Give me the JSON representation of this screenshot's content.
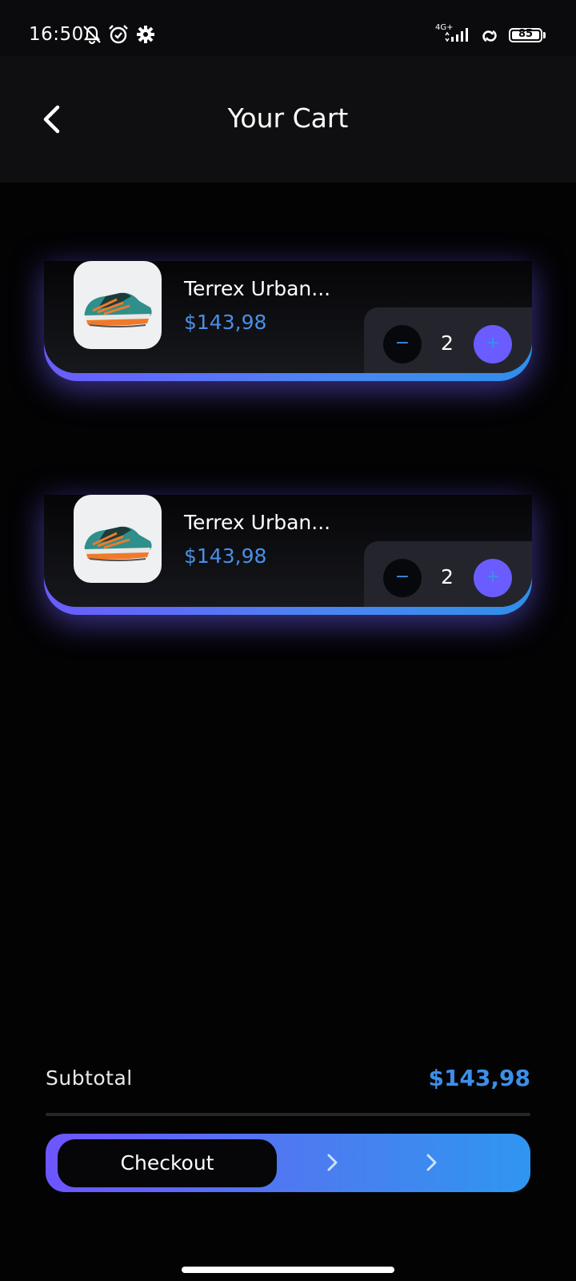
{
  "status_bar": {
    "time": "16:50",
    "network": "4G+",
    "battery": "85",
    "icons": [
      "bell-muted-icon",
      "alarm-icon",
      "settings-icon",
      "signal-icon",
      "hotspot-icon",
      "battery-icon"
    ]
  },
  "header": {
    "title": "Your Cart",
    "back_icon": "chevron-left-icon"
  },
  "cart": {
    "items": [
      {
        "name": "Terrex Urban...",
        "price": "$143,98",
        "quantity": "2",
        "minus": "−",
        "plus": "+",
        "image": "trail-shoe-teal-orange"
      },
      {
        "name": "Terrex Urban...",
        "price": "$143,98",
        "quantity": "2",
        "minus": "−",
        "plus": "+",
        "image": "trail-shoe-teal-orange"
      }
    ]
  },
  "summary": {
    "subtotal_label": "Subtotal",
    "subtotal_value": "$143,98"
  },
  "checkout": {
    "label": "Checkout",
    "arrow_icon": "chevron-right-icon"
  },
  "colors": {
    "accent_purple": "#6a5cff",
    "accent_blue": "#3c8fe9",
    "background": "#030304"
  }
}
